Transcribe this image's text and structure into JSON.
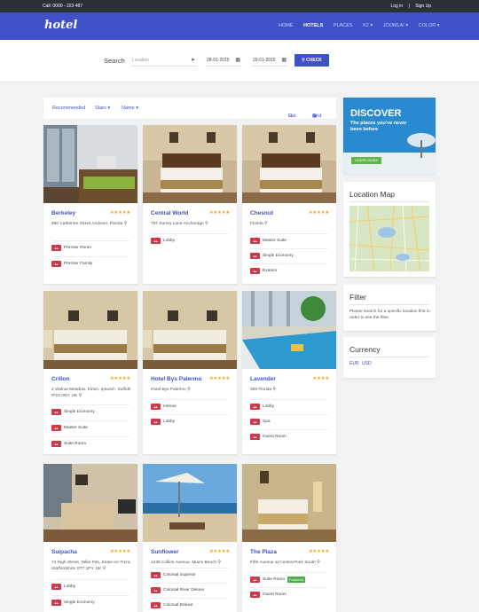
{
  "topbar": {
    "phone": "Call: 0000 - 223 487",
    "login": "Log in",
    "separator": "|",
    "signup": "Sign Up"
  },
  "brand": {
    "logo": "hotel"
  },
  "nav": {
    "home": "HOME",
    "hotels": "HOTELS",
    "places": "PLACES",
    "k2": "K2 ▾",
    "joomla": "JOOMLA! ▾",
    "color": "COLOR ▾"
  },
  "search": {
    "label": "Search",
    "location_placeholder": "Location",
    "checkin": "28-01-2015",
    "checkout": "29-01-2015",
    "button": "CHECK"
  },
  "filters": {
    "recommended": "Recommended",
    "stars": "Stars ▾",
    "name": "Name ▾",
    "list": "List",
    "grid": "Grid"
  },
  "hotels": [
    {
      "name": "Berkeley",
      "stars": "★★★★★",
      "address": "860 Catherine Street Andover, Florida",
      "amenities": [
        "Premier Room",
        "Premier Family"
      ]
    },
    {
      "name": "Central World",
      "stars": "★★★★★",
      "address": "797 Surrey Lane Anchorage",
      "amenities": [
        "Lobby"
      ]
    },
    {
      "name": "Chesnut",
      "stars": "★★★★★",
      "address": "Florida",
      "amenities": [
        "Master Suite",
        "Single Economy",
        "Exterior"
      ]
    },
    {
      "name": "Crillon",
      "stars": "★★★★★",
      "address": "2 Walnut Meadow, Kirton, Ipswich, Suffolk IP10 0NY, UK",
      "amenities": [
        "Single Economy",
        "Master Suite",
        "Suite Room"
      ]
    },
    {
      "name": "Hotel Bys Palermo",
      "stars": "★★★★★",
      "address": "Hotel Bys Palermo",
      "amenities": [
        "Interior",
        "Lobby"
      ]
    },
    {
      "name": "Lavender",
      "stars": "★★★★",
      "address": "359 Florida",
      "amenities": [
        "Lobby",
        "Spa",
        "Guest Room"
      ]
    },
    {
      "name": "Suipacha",
      "stars": "★★★★★",
      "address": "74 High Street, Talke Pits, Stoke-on-Trent, Staffordshire ST7 1PY, UK",
      "amenities": [
        "Lobby",
        "Single Economy"
      ]
    },
    {
      "name": "Sunflower",
      "stars": "★★★★★",
      "address": "1238 Collins Avenue, Miami Beach",
      "amenities": [
        "Colonial Superior",
        "Colonial River Deluxe",
        "Colonial Deluxe"
      ]
    },
    {
      "name": "The Plaza",
      "stars": "★★★★★",
      "address": "Fifth Avenue at Central Park South",
      "amenities": [
        "Suite Room",
        "Guest Room"
      ],
      "badge": "Featured"
    }
  ],
  "sidebar": {
    "ad_title": "DISCOVER",
    "ad_text": "The places you've never been before",
    "ad_button": "LEARN MORE",
    "map_title": "Location Map",
    "filter_title": "Filter",
    "filter_text": "Please search for a specific location first in order to see the filter.",
    "currency_title": "Currency",
    "currencies": [
      "EUR",
      "USD"
    ]
  },
  "colors": {
    "brand": "#3e51c7",
    "star": "#f0ad19",
    "amenity": "#d0394a",
    "featured": "#4cae4c"
  },
  "icons": {
    "location": "map-pin-icon",
    "calendar": "calendar-icon",
    "search": "search-icon",
    "list": "list-icon",
    "grid": "grid-icon",
    "amenity": "room-icon"
  }
}
